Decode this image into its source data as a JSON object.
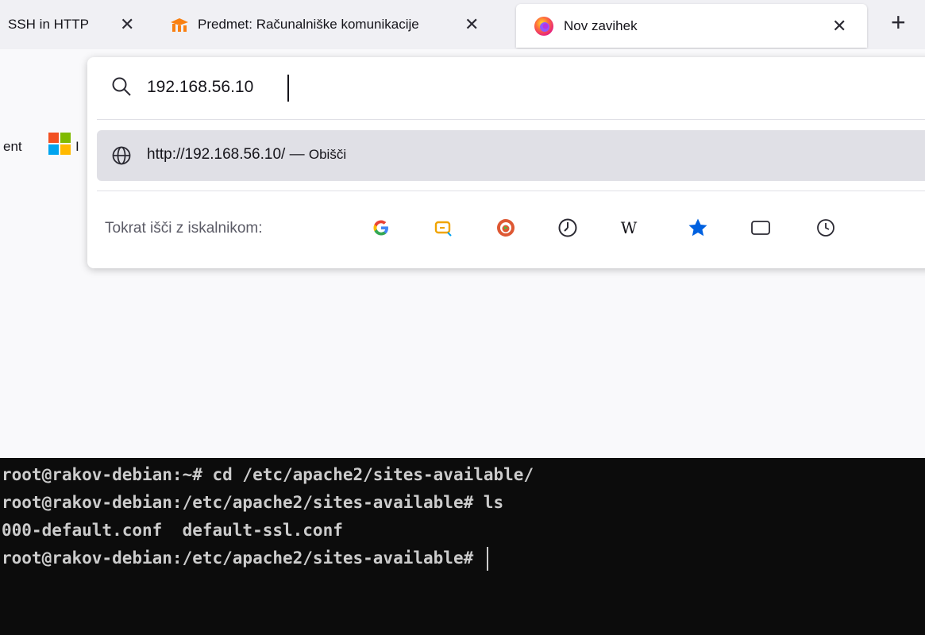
{
  "browser": {
    "tabs": [
      {
        "label": "SSH in HTTP",
        "close": "✕",
        "icon": "none"
      },
      {
        "label": "Predmet: Računalniške komunikacije",
        "close": "✕",
        "icon": "moodle-icon"
      },
      {
        "label": "Nov zavihek",
        "close": "✕",
        "icon": "firefox-icon",
        "active": true
      }
    ],
    "new_tab": "+",
    "bookmarks": {
      "item1": "ent",
      "item2": "I"
    }
  },
  "urlbar": {
    "value": "192.168.56.10",
    "suggestion": {
      "url": "http://192.168.56.10/",
      "separator": " — ",
      "action": "Obišči"
    },
    "engines_label": "Tokrat išči z iskalnikom:",
    "engines": [
      "google-icon",
      "bing-icon",
      "duckduckgo-icon",
      "ecosia-icon",
      "wikipedia-icon",
      "bookmarks-star-icon",
      "tabs-icon",
      "history-icon"
    ]
  },
  "terminal": {
    "lines": [
      "root@rakov-debian:~# cd /etc/apache2/sites-available/",
      "root@rakov-debian:/etc/apache2/sites-available# ls",
      "000-default.conf  default-ssl.conf",
      "root@rakov-debian:/etc/apache2/sites-available# "
    ]
  },
  "colors": {
    "accent_blue": "#0061e0",
    "terminal_bg": "#0c0c0c",
    "terminal_fg": "#cccccc"
  }
}
